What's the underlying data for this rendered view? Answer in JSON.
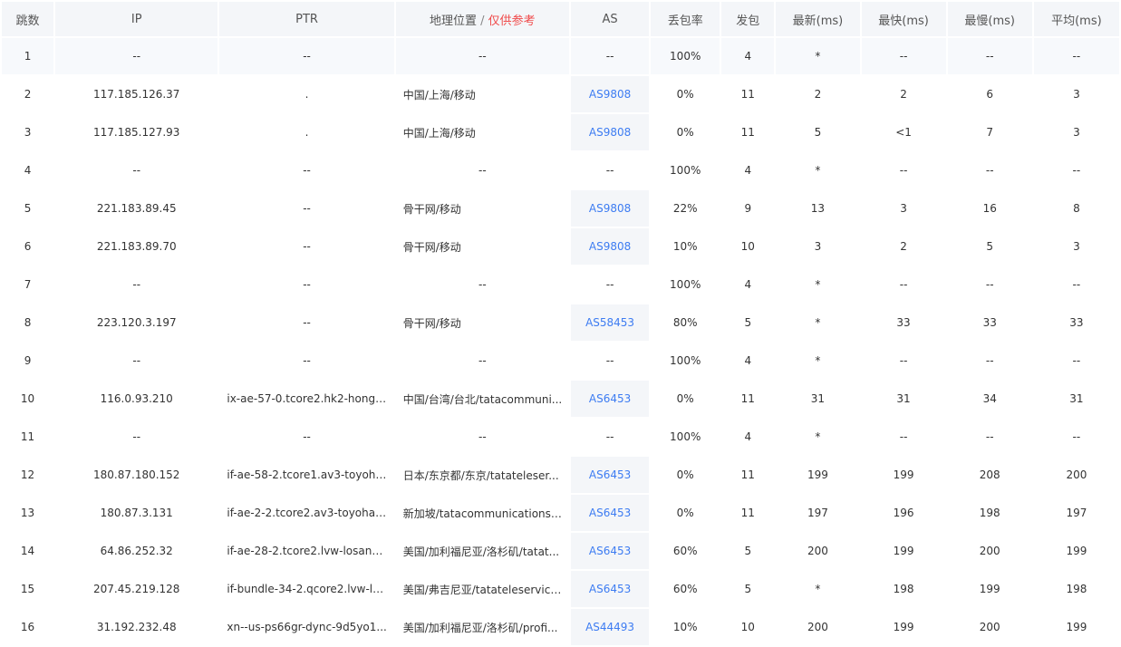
{
  "accent_color": "#3d7cf2",
  "hint_color": "#f04b4b",
  "headers": {
    "hop": "跳数",
    "ip": "IP",
    "ptr": "PTR",
    "geo": "地理位置",
    "geo_sep": " / ",
    "geo_hint": "仅供参考",
    "as": "AS",
    "loss": "丢包率",
    "sent": "发包",
    "last": "最新(ms)",
    "best": "最快(ms)",
    "worst": "最慢(ms)",
    "avg": "平均(ms)"
  },
  "rows": [
    {
      "hop": "1",
      "ip": "--",
      "ptr": "--",
      "geo": "--",
      "as": "--",
      "loss": "100%",
      "sent": "4",
      "last": "*",
      "best": "--",
      "worst": "--",
      "avg": "--"
    },
    {
      "hop": "2",
      "ip": "117.185.126.37",
      "ptr": ".",
      "geo": "中国/上海/移动",
      "as": "AS9808",
      "loss": "0%",
      "sent": "11",
      "last": "2",
      "best": "2",
      "worst": "6",
      "avg": "3"
    },
    {
      "hop": "3",
      "ip": "117.185.127.93",
      "ptr": ".",
      "geo": "中国/上海/移动",
      "as": "AS9808",
      "loss": "0%",
      "sent": "11",
      "last": "5",
      "best": "<1",
      "worst": "7",
      "avg": "3"
    },
    {
      "hop": "4",
      "ip": "--",
      "ptr": "--",
      "geo": "--",
      "as": "--",
      "loss": "100%",
      "sent": "4",
      "last": "*",
      "best": "--",
      "worst": "--",
      "avg": "--"
    },
    {
      "hop": "5",
      "ip": "221.183.89.45",
      "ptr": "--",
      "geo": "骨干网/移动",
      "as": "AS9808",
      "loss": "22%",
      "sent": "9",
      "last": "13",
      "best": "3",
      "worst": "16",
      "avg": "8"
    },
    {
      "hop": "6",
      "ip": "221.183.89.70",
      "ptr": "--",
      "geo": "骨干网/移动",
      "as": "AS9808",
      "loss": "10%",
      "sent": "10",
      "last": "3",
      "best": "2",
      "worst": "5",
      "avg": "3"
    },
    {
      "hop": "7",
      "ip": "--",
      "ptr": "--",
      "geo": "--",
      "as": "--",
      "loss": "100%",
      "sent": "4",
      "last": "*",
      "best": "--",
      "worst": "--",
      "avg": "--"
    },
    {
      "hop": "8",
      "ip": "223.120.3.197",
      "ptr": "--",
      "geo": "骨干网/移动",
      "as": "AS58453",
      "loss": "80%",
      "sent": "5",
      "last": "*",
      "best": "33",
      "worst": "33",
      "avg": "33"
    },
    {
      "hop": "9",
      "ip": "--",
      "ptr": "--",
      "geo": "--",
      "as": "--",
      "loss": "100%",
      "sent": "4",
      "last": "*",
      "best": "--",
      "worst": "--",
      "avg": "--"
    },
    {
      "hop": "10",
      "ip": "116.0.93.210",
      "ptr": "ix-ae-57-0.tcore2.hk2-hongk...",
      "geo": "中国/台湾/台北/tatacommuni...",
      "as": "AS6453",
      "loss": "0%",
      "sent": "11",
      "last": "31",
      "best": "31",
      "worst": "34",
      "avg": "31"
    },
    {
      "hop": "11",
      "ip": "--",
      "ptr": "--",
      "geo": "--",
      "as": "--",
      "loss": "100%",
      "sent": "4",
      "last": "*",
      "best": "--",
      "worst": "--",
      "avg": "--"
    },
    {
      "hop": "12",
      "ip": "180.87.180.152",
      "ptr": "if-ae-58-2.tcore1.av3-toyoha...",
      "geo": "日本/东京都/东京/tatateleser...",
      "as": "AS6453",
      "loss": "0%",
      "sent": "11",
      "last": "199",
      "best": "199",
      "worst": "208",
      "avg": "200"
    },
    {
      "hop": "13",
      "ip": "180.87.3.131",
      "ptr": "if-ae-2-2.tcore2.av3-toyohas...",
      "geo": "新加坡/tatacommunications....",
      "as": "AS6453",
      "loss": "0%",
      "sent": "11",
      "last": "197",
      "best": "196",
      "worst": "198",
      "avg": "197"
    },
    {
      "hop": "14",
      "ip": "64.86.252.32",
      "ptr": "if-ae-28-2.tcore2.lvw-losang...",
      "geo": "美国/加利福尼亚/洛杉矶/tatat...",
      "as": "AS6453",
      "loss": "60%",
      "sent": "5",
      "last": "200",
      "best": "199",
      "worst": "200",
      "avg": "199"
    },
    {
      "hop": "15",
      "ip": "207.45.219.128",
      "ptr": "if-bundle-34-2.qcore2.lvw-lo...",
      "geo": "美国/弗吉尼亚/tatateleservice...",
      "as": "AS6453",
      "loss": "60%",
      "sent": "5",
      "last": "*",
      "best": "198",
      "worst": "199",
      "avg": "198"
    },
    {
      "hop": "16",
      "ip": "31.192.232.48",
      "ptr": "xn--us-ps66gr-dync-9d5yo1...",
      "geo": "美国/加利福尼亚/洛杉矶/profi...",
      "as": "AS44493",
      "loss": "10%",
      "sent": "10",
      "last": "200",
      "best": "199",
      "worst": "200",
      "avg": "199"
    }
  ]
}
